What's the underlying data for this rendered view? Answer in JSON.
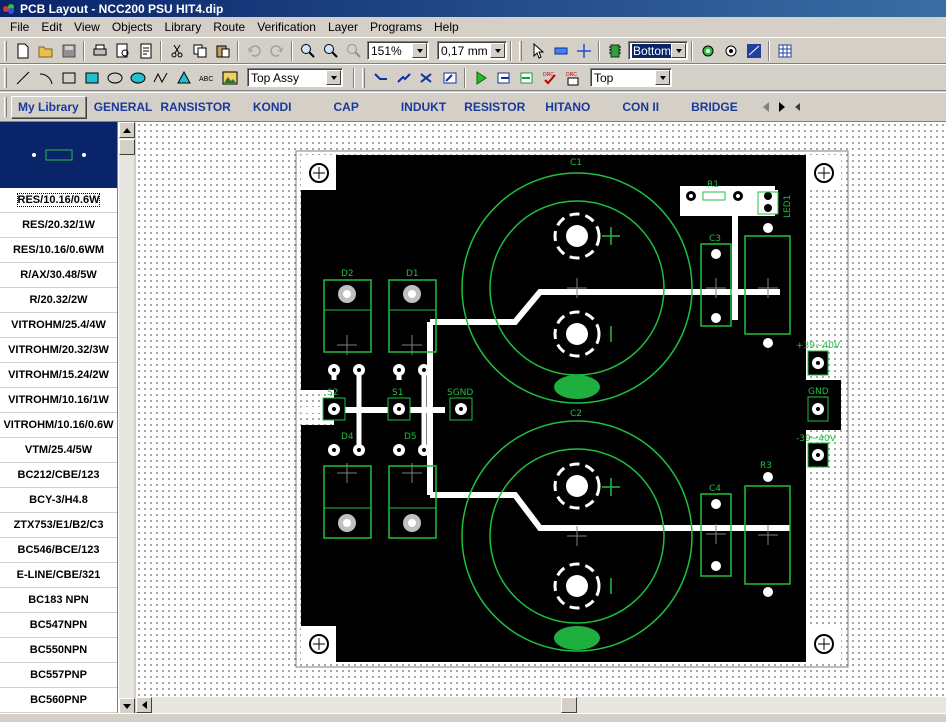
{
  "window": {
    "title": "PCB Layout - NCC200 PSU HIT4.dip"
  },
  "menu": [
    "File",
    "Edit",
    "View",
    "Objects",
    "Library",
    "Route",
    "Verification",
    "Layer",
    "Programs",
    "Help"
  ],
  "toolbar": {
    "zoom": "151%",
    "line_width": "0,17 mm",
    "layer": "Bottom",
    "assy_layer": "Top Assy",
    "route_layer": "Top"
  },
  "library_tabs": [
    "My Library",
    "GENERAL",
    "RANSISTOR",
    "KONDI",
    "CAP",
    "INDUKT",
    "RESISTOR",
    "HITANO",
    "CON II",
    "BRIDGE"
  ],
  "components": [
    "RES/10.16/0.6W",
    "RES/20.32/1W",
    "RES/10.16/0.6WM",
    "R/AX/30.48/5W",
    "R/20.32/2W",
    "VITROHM/25.4/4W",
    "VITROHM/20.32/3W",
    "VITROHM/15.24/2W",
    "VITROHM/10.16/1W",
    "VITROHM/10.16/0.6W",
    "VTM/25.4/5W",
    "BC212/CBE/123",
    "BCY-3/H4.8",
    "ZTX753/E1/B2/C3",
    "BC546/BCE/123",
    "E-LINE/CBE/321",
    "BC183 NPN",
    "BC547NPN",
    "BC550NPN",
    "BC557PNP",
    "BC560PNP"
  ],
  "pcb_labels": {
    "c1": "C1",
    "c2": "C2",
    "c3": "C3",
    "c4": "C4",
    "r1": "R1",
    "r3": "R3",
    "led1": "LED1",
    "d1": "D1",
    "d2": "D2",
    "d4": "D4",
    "d5": "D5",
    "s1": "S1",
    "s2": "S2",
    "sgnd": "SGND",
    "plus40": "+39~40V",
    "gnd": "GND",
    "minus40": "-39~40V"
  },
  "colors": {
    "board": "#000000",
    "silk": "#1fbf3f",
    "copper": "#ffffff",
    "selection": "#0a246a"
  }
}
